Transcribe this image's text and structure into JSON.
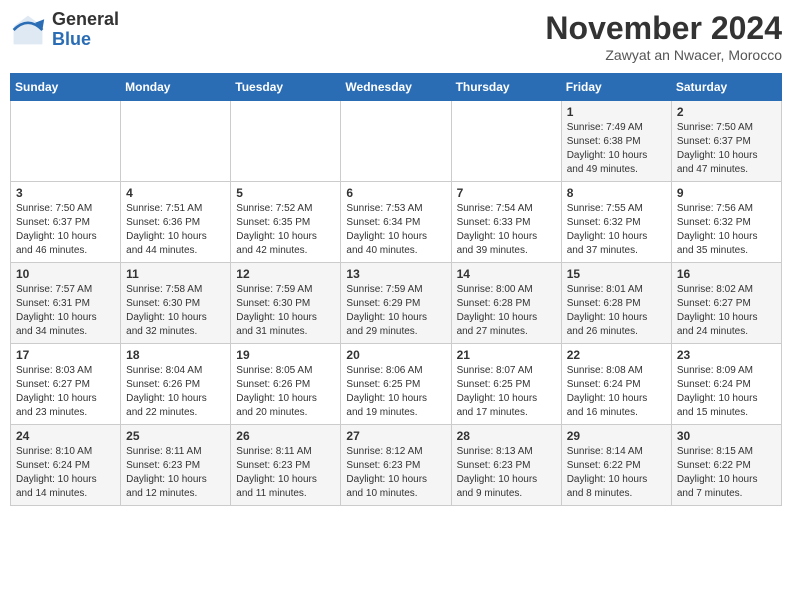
{
  "header": {
    "logo_general": "General",
    "logo_blue": "Blue",
    "month_title": "November 2024",
    "location": "Zawyat an Nwacer, Morocco"
  },
  "weekdays": [
    "Sunday",
    "Monday",
    "Tuesday",
    "Wednesday",
    "Thursday",
    "Friday",
    "Saturday"
  ],
  "weeks": [
    [
      {
        "day": "",
        "info": ""
      },
      {
        "day": "",
        "info": ""
      },
      {
        "day": "",
        "info": ""
      },
      {
        "day": "",
        "info": ""
      },
      {
        "day": "",
        "info": ""
      },
      {
        "day": "1",
        "info": "Sunrise: 7:49 AM\nSunset: 6:38 PM\nDaylight: 10 hours and 49 minutes."
      },
      {
        "day": "2",
        "info": "Sunrise: 7:50 AM\nSunset: 6:37 PM\nDaylight: 10 hours and 47 minutes."
      }
    ],
    [
      {
        "day": "3",
        "info": "Sunrise: 7:50 AM\nSunset: 6:37 PM\nDaylight: 10 hours and 46 minutes."
      },
      {
        "day": "4",
        "info": "Sunrise: 7:51 AM\nSunset: 6:36 PM\nDaylight: 10 hours and 44 minutes."
      },
      {
        "day": "5",
        "info": "Sunrise: 7:52 AM\nSunset: 6:35 PM\nDaylight: 10 hours and 42 minutes."
      },
      {
        "day": "6",
        "info": "Sunrise: 7:53 AM\nSunset: 6:34 PM\nDaylight: 10 hours and 40 minutes."
      },
      {
        "day": "7",
        "info": "Sunrise: 7:54 AM\nSunset: 6:33 PM\nDaylight: 10 hours and 39 minutes."
      },
      {
        "day": "8",
        "info": "Sunrise: 7:55 AM\nSunset: 6:32 PM\nDaylight: 10 hours and 37 minutes."
      },
      {
        "day": "9",
        "info": "Sunrise: 7:56 AM\nSunset: 6:32 PM\nDaylight: 10 hours and 35 minutes."
      }
    ],
    [
      {
        "day": "10",
        "info": "Sunrise: 7:57 AM\nSunset: 6:31 PM\nDaylight: 10 hours and 34 minutes."
      },
      {
        "day": "11",
        "info": "Sunrise: 7:58 AM\nSunset: 6:30 PM\nDaylight: 10 hours and 32 minutes."
      },
      {
        "day": "12",
        "info": "Sunrise: 7:59 AM\nSunset: 6:30 PM\nDaylight: 10 hours and 31 minutes."
      },
      {
        "day": "13",
        "info": "Sunrise: 7:59 AM\nSunset: 6:29 PM\nDaylight: 10 hours and 29 minutes."
      },
      {
        "day": "14",
        "info": "Sunrise: 8:00 AM\nSunset: 6:28 PM\nDaylight: 10 hours and 27 minutes."
      },
      {
        "day": "15",
        "info": "Sunrise: 8:01 AM\nSunset: 6:28 PM\nDaylight: 10 hours and 26 minutes."
      },
      {
        "day": "16",
        "info": "Sunrise: 8:02 AM\nSunset: 6:27 PM\nDaylight: 10 hours and 24 minutes."
      }
    ],
    [
      {
        "day": "17",
        "info": "Sunrise: 8:03 AM\nSunset: 6:27 PM\nDaylight: 10 hours and 23 minutes."
      },
      {
        "day": "18",
        "info": "Sunrise: 8:04 AM\nSunset: 6:26 PM\nDaylight: 10 hours and 22 minutes."
      },
      {
        "day": "19",
        "info": "Sunrise: 8:05 AM\nSunset: 6:26 PM\nDaylight: 10 hours and 20 minutes."
      },
      {
        "day": "20",
        "info": "Sunrise: 8:06 AM\nSunset: 6:25 PM\nDaylight: 10 hours and 19 minutes."
      },
      {
        "day": "21",
        "info": "Sunrise: 8:07 AM\nSunset: 6:25 PM\nDaylight: 10 hours and 17 minutes."
      },
      {
        "day": "22",
        "info": "Sunrise: 8:08 AM\nSunset: 6:24 PM\nDaylight: 10 hours and 16 minutes."
      },
      {
        "day": "23",
        "info": "Sunrise: 8:09 AM\nSunset: 6:24 PM\nDaylight: 10 hours and 15 minutes."
      }
    ],
    [
      {
        "day": "24",
        "info": "Sunrise: 8:10 AM\nSunset: 6:24 PM\nDaylight: 10 hours and 14 minutes."
      },
      {
        "day": "25",
        "info": "Sunrise: 8:11 AM\nSunset: 6:23 PM\nDaylight: 10 hours and 12 minutes."
      },
      {
        "day": "26",
        "info": "Sunrise: 8:11 AM\nSunset: 6:23 PM\nDaylight: 10 hours and 11 minutes."
      },
      {
        "day": "27",
        "info": "Sunrise: 8:12 AM\nSunset: 6:23 PM\nDaylight: 10 hours and 10 minutes."
      },
      {
        "day": "28",
        "info": "Sunrise: 8:13 AM\nSunset: 6:23 PM\nDaylight: 10 hours and 9 minutes."
      },
      {
        "day": "29",
        "info": "Sunrise: 8:14 AM\nSunset: 6:22 PM\nDaylight: 10 hours and 8 minutes."
      },
      {
        "day": "30",
        "info": "Sunrise: 8:15 AM\nSunset: 6:22 PM\nDaylight: 10 hours and 7 minutes."
      }
    ]
  ]
}
